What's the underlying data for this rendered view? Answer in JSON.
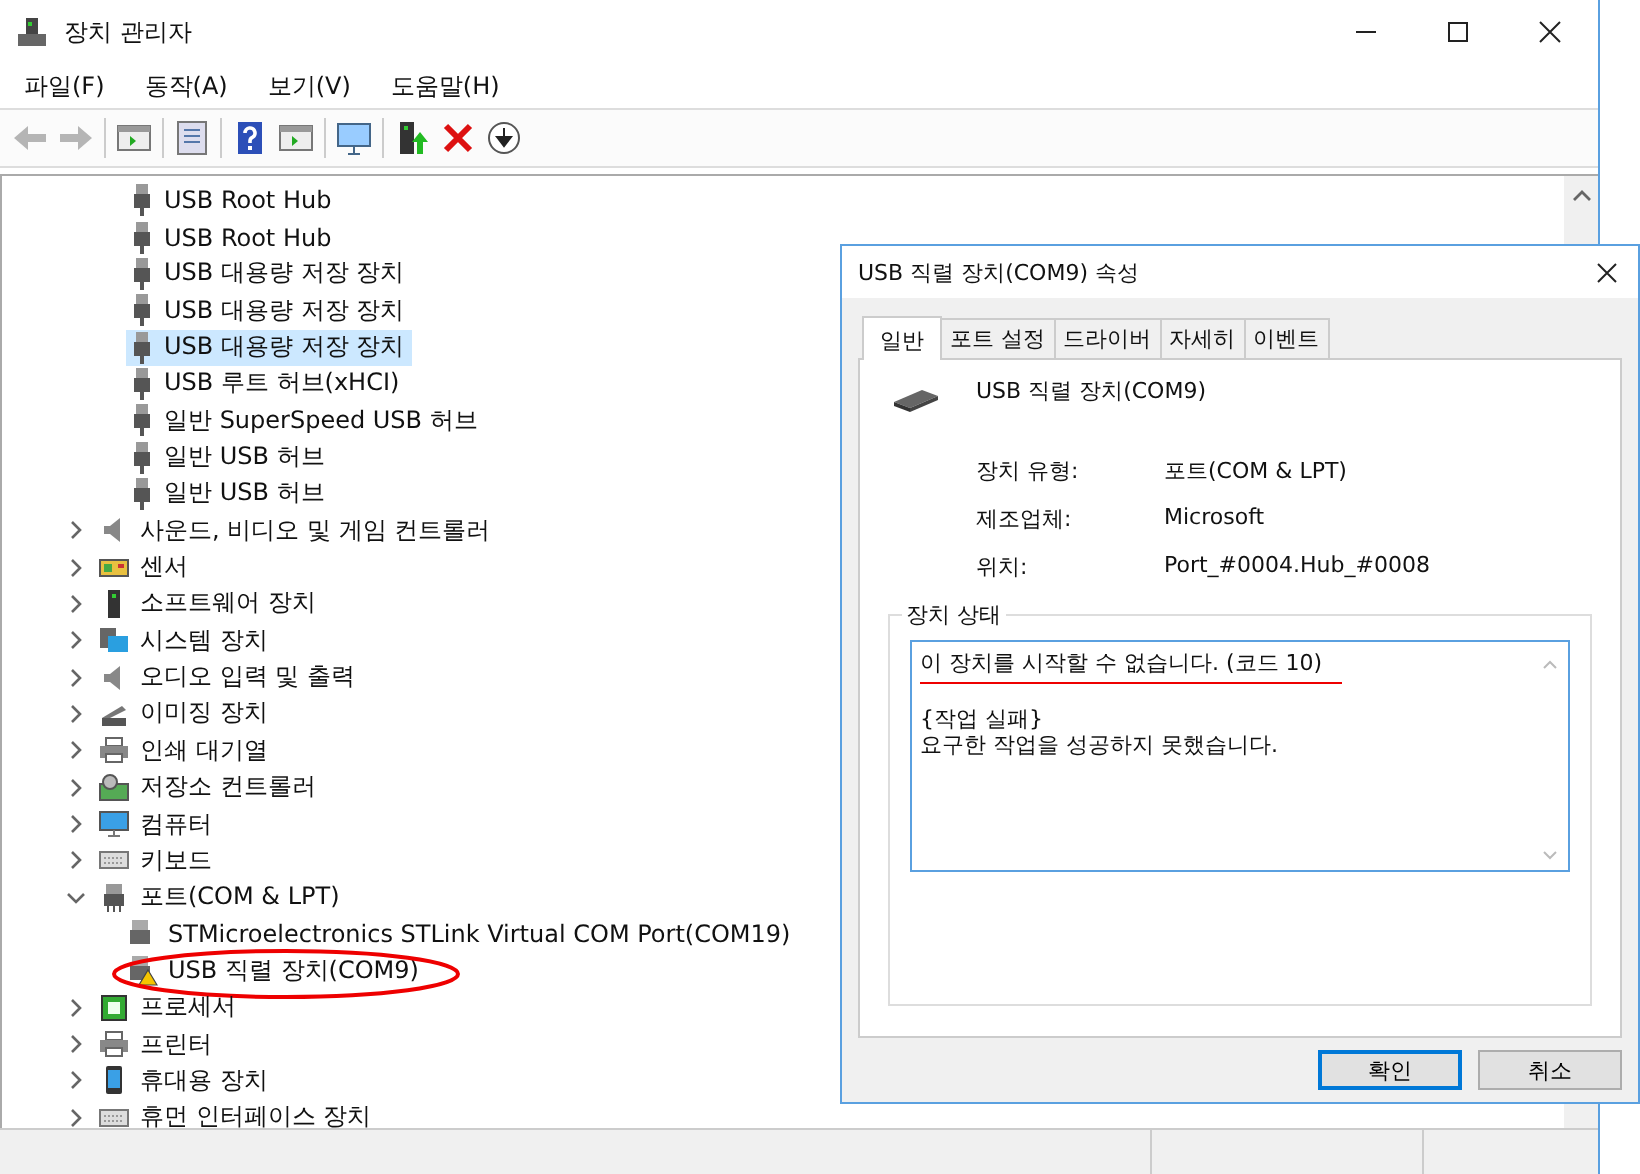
{
  "window": {
    "title": "장치 관리자"
  },
  "menu": [
    "파일(F)",
    "동작(A)",
    "보기(V)",
    "도움말(H)"
  ],
  "toolbar": [
    {
      "kind": "back",
      "disabled": true
    },
    {
      "kind": "forward",
      "disabled": true
    },
    {
      "kind": "sep"
    },
    {
      "kind": "tree",
      "disabled": false
    },
    {
      "kind": "sep"
    },
    {
      "kind": "props",
      "disabled": false
    },
    {
      "kind": "sep"
    },
    {
      "kind": "help",
      "disabled": false
    },
    {
      "kind": "pane",
      "disabled": false
    },
    {
      "kind": "sep"
    },
    {
      "kind": "scan",
      "disabled": false
    },
    {
      "kind": "sep"
    },
    {
      "kind": "update",
      "disabled": false
    },
    {
      "kind": "remove",
      "disabled": false
    },
    {
      "kind": "download",
      "disabled": false
    }
  ],
  "tree": {
    "continued_items": [
      {
        "label": "USB Root Hub",
        "selected": false
      },
      {
        "label": "USB Root Hub",
        "selected": false
      },
      {
        "label": "USB 대용량 저장 장치",
        "selected": false
      },
      {
        "label": "USB 대용량 저장 장치",
        "selected": false
      },
      {
        "label": "USB 대용량 저장 장치",
        "selected": true
      },
      {
        "label": "USB 루트 허브(xHCI)",
        "selected": false
      },
      {
        "label": "일반 SuperSpeed USB 허브",
        "selected": false
      },
      {
        "label": "일반 USB 허브",
        "selected": false
      },
      {
        "label": "일반 USB 허브",
        "selected": false
      }
    ],
    "categories": [
      {
        "label": "사운드, 비디오 및 게임 컨트롤러",
        "kind": "sound",
        "expanded": false,
        "selected": false
      },
      {
        "label": "센서",
        "kind": "sensor",
        "expanded": false,
        "selected": false
      },
      {
        "label": "소프트웨어 장치",
        "kind": "software",
        "expanded": false,
        "selected": false
      },
      {
        "label": "시스템 장치",
        "kind": "system",
        "expanded": false,
        "selected": false
      },
      {
        "label": "오디오 입력 및 출력",
        "kind": "sound",
        "expanded": false,
        "selected": false
      },
      {
        "label": "이미징 장치",
        "kind": "imaging",
        "expanded": false,
        "selected": false
      },
      {
        "label": "인쇄 대기열",
        "kind": "printer",
        "expanded": false,
        "selected": false
      },
      {
        "label": "저장소 컨트롤러",
        "kind": "storage",
        "expanded": false,
        "selected": false
      },
      {
        "label": "컴퓨터",
        "kind": "computer",
        "expanded": false,
        "selected": false
      },
      {
        "label": "키보드",
        "kind": "keyboard",
        "expanded": false,
        "selected": false
      },
      {
        "label": "포트(COM & LPT)",
        "kind": "port",
        "expanded": true,
        "selected": false,
        "children": [
          {
            "label": "STMicroelectronics STLink Virtual COM Port(COM19)",
            "selected": false,
            "warning": false,
            "circled": false
          },
          {
            "label": "USB 직렬 장치(COM9)",
            "selected": false,
            "warning": true,
            "circled": true
          }
        ]
      },
      {
        "label": "프로세서",
        "kind": "processor",
        "expanded": false,
        "selected": false
      },
      {
        "label": "프린터",
        "kind": "printer",
        "expanded": false,
        "selected": false
      },
      {
        "label": "휴대용 장치",
        "kind": "portable",
        "expanded": false,
        "selected": false
      },
      {
        "label": "휴먼 인터페이스 장치",
        "kind": "keyboard",
        "expanded": false,
        "selected": false
      }
    ]
  },
  "dialog": {
    "title": "USB 직렬 장치(COM9) 속성",
    "tabs": [
      {
        "label": "일반",
        "selected": true
      },
      {
        "label": "포트 설정",
        "selected": false
      },
      {
        "label": "드라이버",
        "selected": false
      },
      {
        "label": "자세히",
        "selected": false
      },
      {
        "label": "이벤트",
        "selected": false
      }
    ],
    "device_name": "USB 직렬 장치(COM9)",
    "properties": [
      {
        "label": "장치 유형:",
        "value": "포트(COM & LPT)"
      },
      {
        "label": "제조업체:",
        "value": "Microsoft"
      },
      {
        "label": "위치:",
        "value": "Port_#0004.Hub_#0008"
      }
    ],
    "status_group": {
      "title": "장치 상태",
      "lines": [
        {
          "text": "이 장치를 시작할 수 없습니다. (코드 10)",
          "underlined": true
        },
        {
          "text": "{작업 실패}",
          "underlined": false
        },
        {
          "text": "요구한 작업을 성공하지 못했습니다.",
          "underlined": false
        }
      ]
    },
    "buttons": [
      {
        "label": "확인",
        "default": true
      },
      {
        "label": "취소",
        "default": false
      }
    ]
  }
}
